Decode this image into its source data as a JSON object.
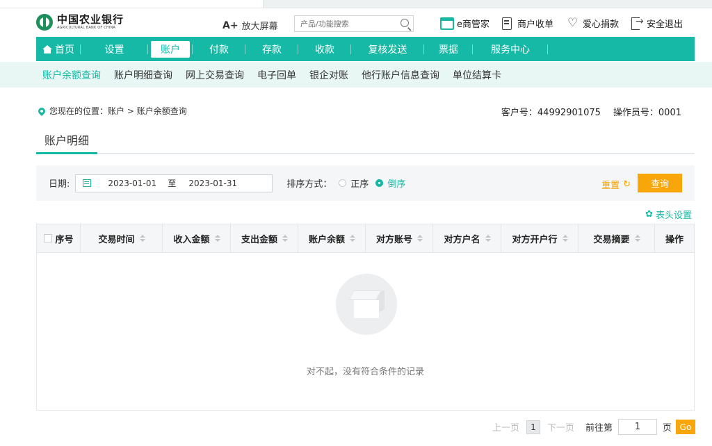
{
  "header": {
    "logo_cn": "中国农业银行",
    "logo_en": "AGRICULTURAL BANK OF CHINA",
    "enlarge_a": "A+",
    "enlarge_label": "放大屏幕",
    "search_placeholder": "产品/功能搜索",
    "links": [
      "e商管家",
      "商户收单",
      "爱心捐款",
      "安全退出"
    ]
  },
  "nav": {
    "items": [
      "首页",
      "设置",
      "账户",
      "付款",
      "存款",
      "收款",
      "复核发送",
      "票据",
      "服务中心"
    ],
    "active": "账户"
  },
  "subnav": {
    "items": [
      "账户余额查询",
      "账户明细查询",
      "网上交易查询",
      "电子回单",
      "银企对账",
      "他行账户信息查询",
      "单位结算卡"
    ],
    "active": "账户余额查询"
  },
  "location": {
    "label": "您现在的位置：",
    "path": "账户 > 账户余额查询",
    "customer_label": "客户号：",
    "customer_no": "44992901075",
    "operator_label": "操作员号：",
    "operator_no": "0001"
  },
  "section_title": "账户明细",
  "filter": {
    "date_label": "日期:",
    "date_from": "2023-01-01",
    "date_to_label": "至",
    "date_to": "2023-01-31",
    "sort_label": "排序方式：",
    "sort_asc": "正序",
    "sort_desc": "倒序",
    "sort_selected": "倒序",
    "reset": "重置",
    "query": "查询"
  },
  "column_settings": "表头设置",
  "table": {
    "columns": [
      "序号",
      "交易时间",
      "收入金额",
      "支出金额",
      "账户余额",
      "对方账号",
      "对方户名",
      "对方开户行",
      "交易摘要",
      "操作"
    ],
    "empty_text": "对不起，没有符合条件的记录"
  },
  "pager": {
    "prev": "上一页",
    "current": "1",
    "next": "下一页",
    "goto_label": "前往第",
    "goto_value": "1",
    "page_label": "页",
    "go": "Go"
  },
  "colors": {
    "accent": "#15b9a5",
    "orange": "#f9a60a",
    "subnav_bg": "#e8f7f4"
  }
}
